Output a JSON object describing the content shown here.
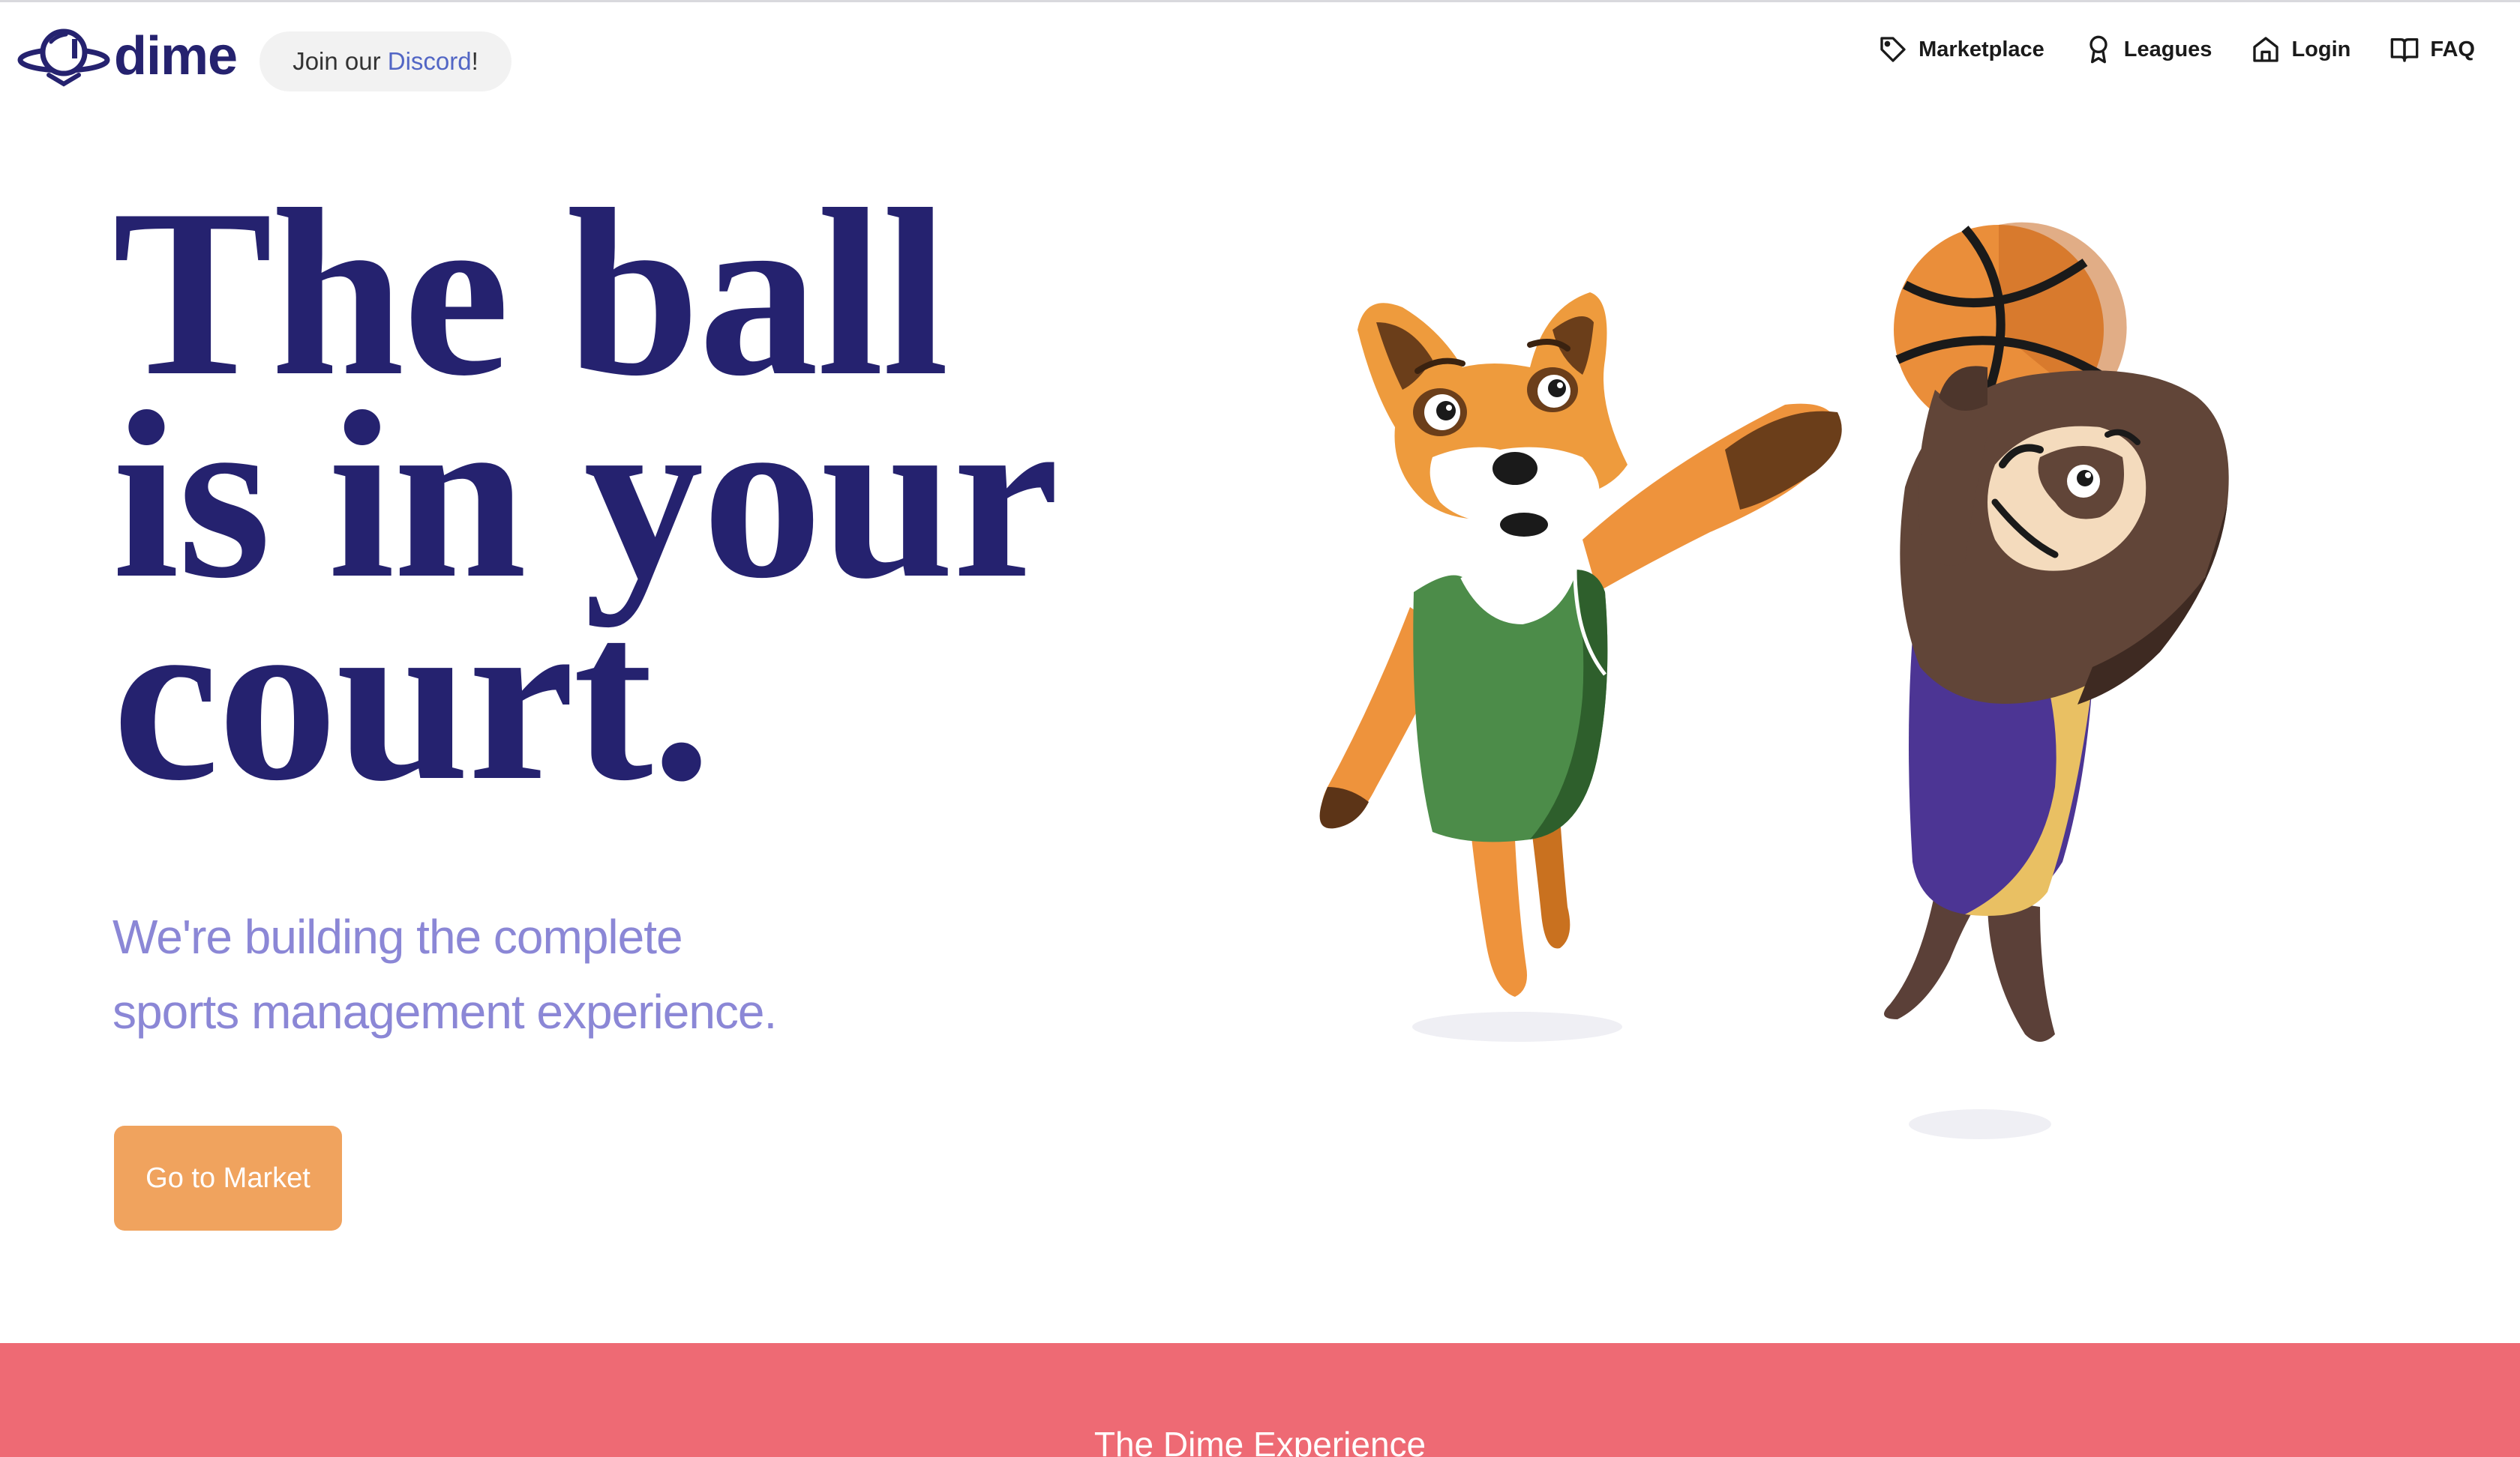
{
  "header": {
    "brand": "dime",
    "discord": {
      "prefix": "Join our ",
      "link": "Discord",
      "suffix": "!"
    },
    "nav": [
      {
        "label": "Marketplace",
        "icon": "tag-icon"
      },
      {
        "label": "Leagues",
        "icon": "award-icon"
      },
      {
        "label": "Login",
        "icon": "home-icon"
      },
      {
        "label": "FAQ",
        "icon": "book-icon"
      }
    ]
  },
  "hero": {
    "title_line1": "The ball",
    "title_line2": "is in your",
    "title_line3": "court.",
    "subtitle_line1": "We're building the complete",
    "subtitle_line2": "sports management experience.",
    "cta": "Go to Market"
  },
  "section": {
    "title": "The Dime Experience"
  },
  "colors": {
    "brand": "#25226f",
    "accent": "#f0a35e",
    "subtitle": "#8b87d6",
    "section_bg": "#ee6a74",
    "discord_link": "#5266c5"
  }
}
